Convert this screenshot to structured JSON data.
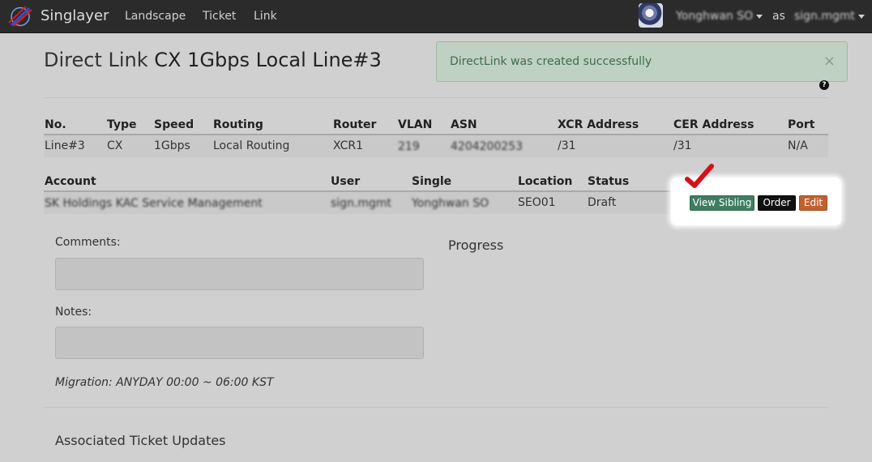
{
  "navbar": {
    "brand": "Singlayer",
    "links": [
      "Landscape",
      "Ticket",
      "Link"
    ],
    "user_name": "Yonghwan SO",
    "as_text": "as",
    "account_name": "sign.mgmt"
  },
  "header": {
    "title_prefix": "Direct Link",
    "title_name": "CX 1Gbps Local Line#3"
  },
  "alert": {
    "message": "DirectLink was created successfully",
    "close": "×"
  },
  "help_icon": "?",
  "link_table": {
    "headers": [
      "No.",
      "Type",
      "Speed",
      "Routing",
      "Router",
      "VLAN",
      "ASN",
      "XCR Address",
      "CER Address",
      "Port"
    ],
    "row": [
      "Line#3",
      "CX",
      "1Gbps",
      "Local Routing",
      "XCR1",
      "219",
      "4204200253",
      "/31",
      "/31",
      "N/A"
    ]
  },
  "account_table": {
    "headers": [
      "Account",
      "User",
      "Single",
      "Location",
      "Status"
    ],
    "row": [
      "SK Holdings KAC Service Management",
      "sign.mgmt",
      "Yonghwan SO",
      "SEO01",
      "Draft"
    ]
  },
  "actions": {
    "view_sibling": "View Sibling",
    "order": "Order",
    "edit": "Edit",
    "highlight_color": "#d6101c"
  },
  "form": {
    "comments_label": "Comments:",
    "notes_label": "Notes:",
    "migration": "Migration: ANYDAY 00:00 ~ 06:00 KST"
  },
  "progress_title": "Progress",
  "ticket_updates_title": "Associated Ticket Updates"
}
